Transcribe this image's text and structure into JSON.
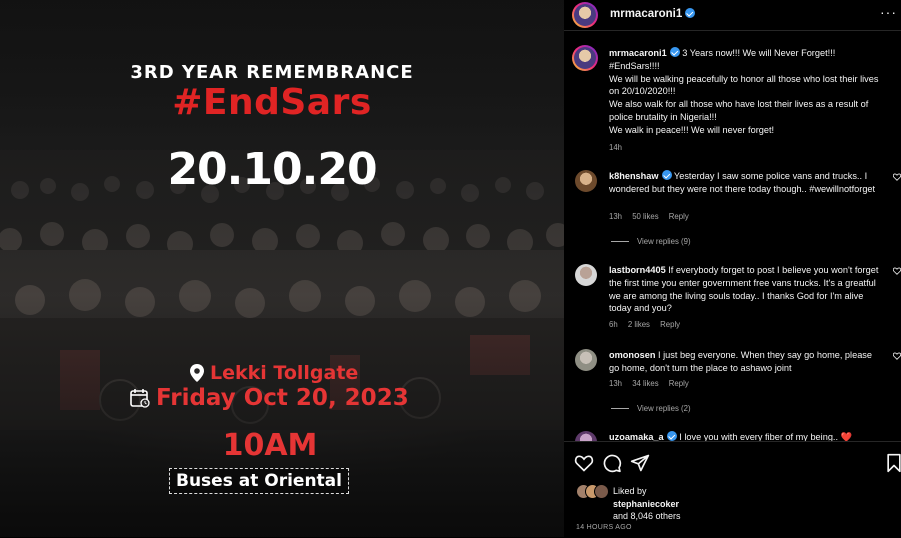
{
  "post_image": {
    "remembrance": "3RD YEAR REMEMBRANCE",
    "hashtag": "#EndSars",
    "date_big": "20.10.20",
    "location": "Lekki Tollgate",
    "event_date": "Friday Oct 20, 2023",
    "time": "10AM",
    "buses": "Buses at Oriental"
  },
  "header": {
    "username": "mrmacaroni1",
    "more": "···"
  },
  "caption": {
    "username": "mrmacaroni1",
    "lines": [
      "3 Years now!!! We will Never Forget!!!",
      "#EndSars!!!!",
      "We will be walking peacefully to honor all those who lost their lives on 20/10/2020!!!",
      "We also walk for all those who have lost their lives as a result of police brutality in Nigeria!!!",
      "We walk in peace!!! We will never forget!"
    ],
    "time": "14h"
  },
  "comments": [
    {
      "username": "k8henshaw",
      "verified": true,
      "text": "Yesterday I saw some police vans and trucks.. I wondered but they were not there today though.. #wewillnotforget",
      "time": "13h",
      "likes": "50 likes",
      "reply": "Reply",
      "view_replies": "View replies (9)"
    },
    {
      "username": "lastborn4405",
      "verified": false,
      "text": "If everybody forget to post I believe you won't forget the first time you enter government free vans trucks. It's a greatful we are among the living souls today.. I thanks God for I'm alive today and you?",
      "time": "6h",
      "likes": "2 likes",
      "reply": "Reply",
      "view_replies": ""
    },
    {
      "username": "omonosen",
      "verified": false,
      "text": "I just beg everyone. When they say go home, please go home, don't turn the place to ashawo joint",
      "time": "13h",
      "likes": "34 likes",
      "reply": "Reply",
      "view_replies": "View replies (2)"
    },
    {
      "username": "uzoamaka_a",
      "verified": true,
      "text": "I love you with every fiber of my being.. ❤️",
      "time": "",
      "likes": "",
      "reply": "",
      "view_replies": ""
    }
  ],
  "likes": {
    "prefix": "Liked by",
    "user": "stephaniecoker",
    "others": "and 8,046 others"
  },
  "post_time": "14 HOURS AGO",
  "colors": {
    "accent_red": "#e53535",
    "verified_blue": "#3897f0",
    "heart_red": "#ff3040"
  }
}
